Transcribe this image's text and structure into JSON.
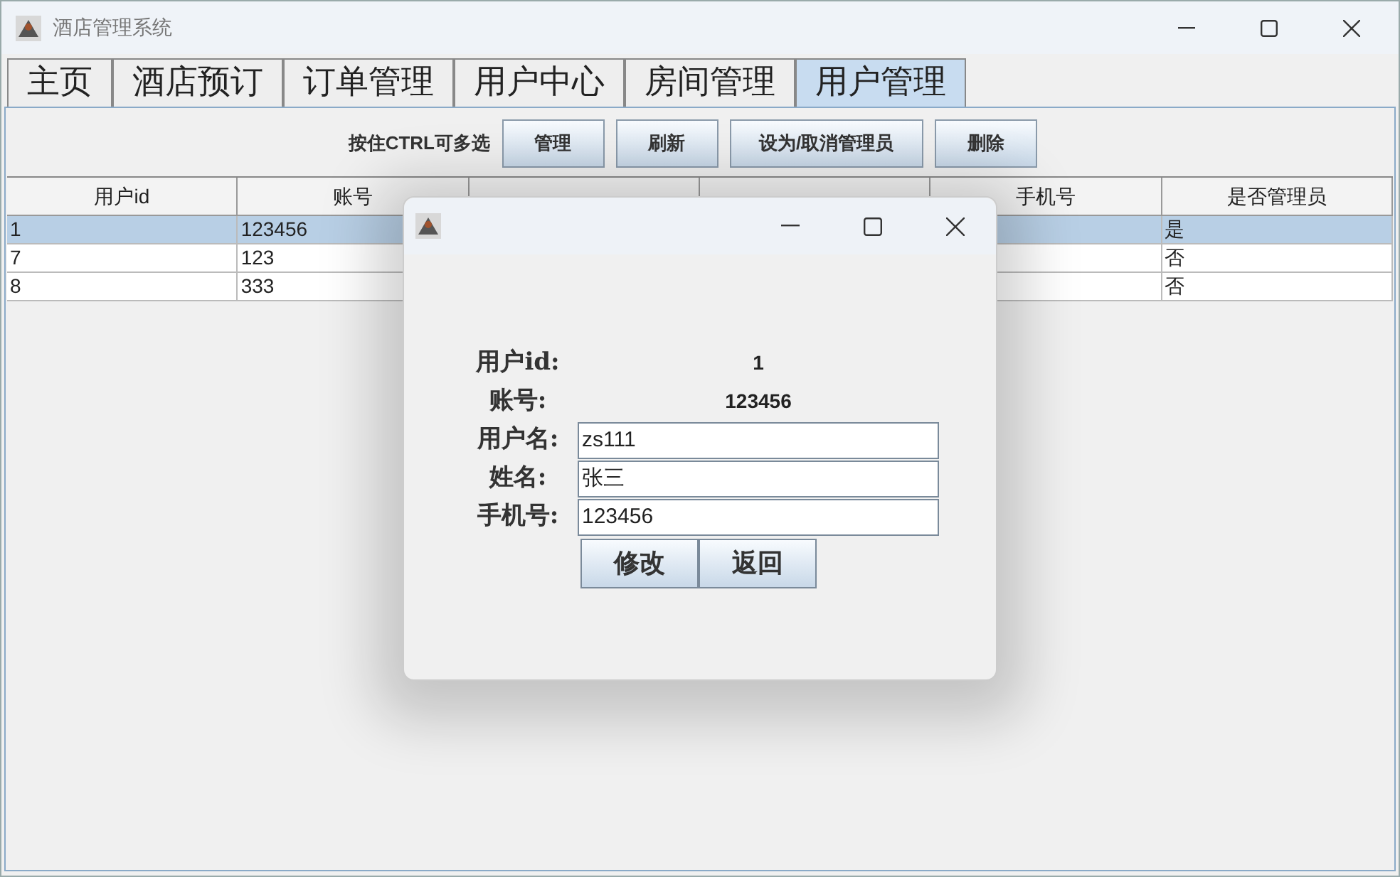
{
  "window": {
    "title": "酒店管理系统"
  },
  "tabs": [
    {
      "label": "主页",
      "selected": false
    },
    {
      "label": "酒店预订",
      "selected": false
    },
    {
      "label": "订单管理",
      "selected": false
    },
    {
      "label": "用户中心",
      "selected": false
    },
    {
      "label": "房间管理",
      "selected": false
    },
    {
      "label": "用户管理",
      "selected": true
    }
  ],
  "toolbar": {
    "hint": "按住CTRL可多选",
    "buttons": [
      "管理",
      "刷新",
      "设为/取消管理员",
      "删除"
    ]
  },
  "table": {
    "columns": [
      "用户id",
      "账号",
      null,
      null,
      "手机号",
      "是否管理员"
    ],
    "rows": [
      {
        "selected": true,
        "cells": [
          "1",
          "123456",
          "是"
        ]
      },
      {
        "selected": false,
        "cells": [
          "7",
          "123",
          "否"
        ]
      },
      {
        "selected": false,
        "cells": [
          "8",
          "333",
          "否"
        ]
      }
    ]
  },
  "dialog": {
    "fields": [
      {
        "kind": "static",
        "label": "用户id:",
        "value": "1"
      },
      {
        "kind": "static",
        "label": "账号:",
        "value": "123456"
      },
      {
        "kind": "input",
        "label": "用户名:",
        "value": "zs111"
      },
      {
        "kind": "input",
        "label": "姓名:",
        "value": "张三"
      },
      {
        "kind": "input",
        "label": "手机号:",
        "value": "123456"
      }
    ],
    "buttons": [
      "修改",
      "返回"
    ]
  }
}
